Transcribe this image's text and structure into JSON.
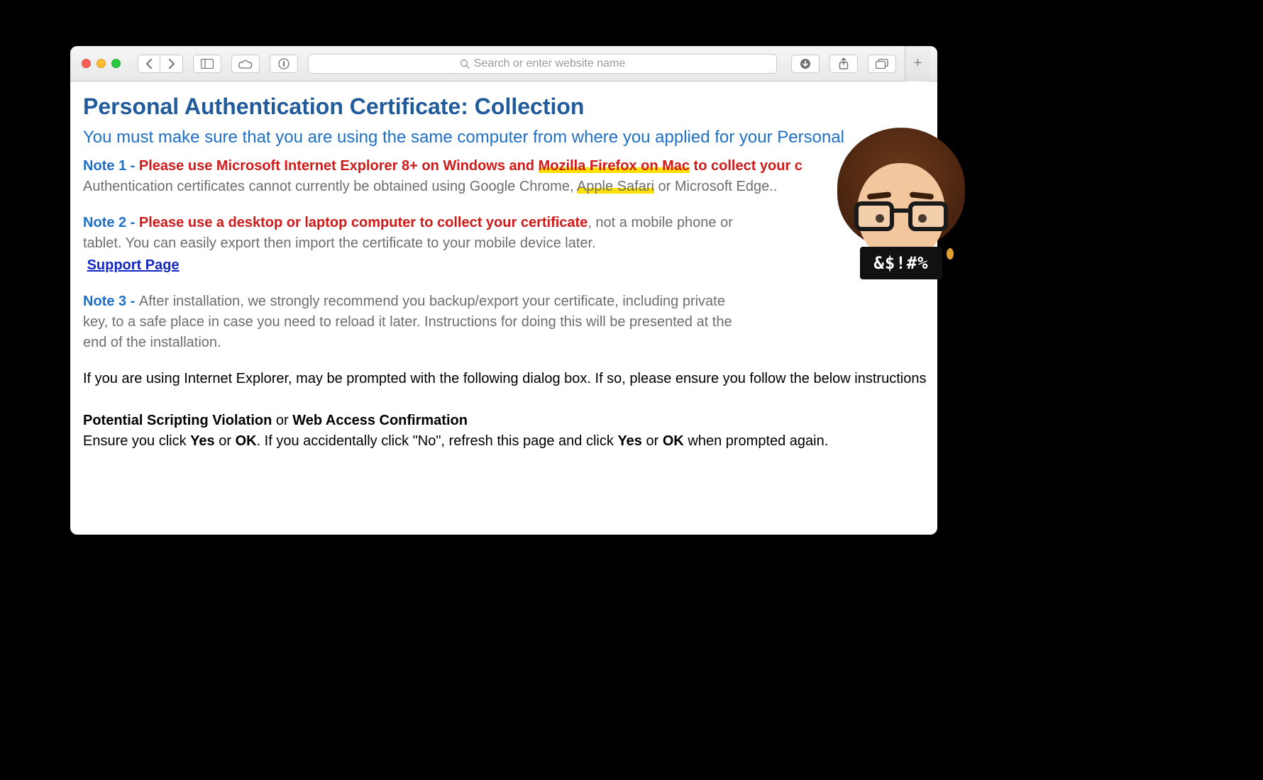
{
  "toolbar": {
    "search_placeholder": "Search or enter website name"
  },
  "page": {
    "title": "Personal Authentication Certificate: Collection",
    "subtitle": "You must make sure that you are using the same computer from where you applied for your Personal",
    "note1_label": "Note 1 - ",
    "note1_red_a": "Please use Microsoft Internet Explorer 8+ on Windows and ",
    "note1_red_hl": "Mozilla Firefox on Mac",
    "note1_red_b": " to collect your c",
    "note1_grey_a": "Authentication certificates cannot currently be obtained using Google Chrome, ",
    "note1_grey_hl": "Apple Safari",
    "note1_grey_b": " or Microsoft Edge..",
    "note2_label": "Note 2 - ",
    "note2_red": "Please use a desktop or laptop computer to collect your certificate",
    "note2_grey": ", not a mobile phone or tablet. You can easily export then import the certificate to your mobile device later.",
    "support_link": "Support Page",
    "note3_label": "Note 3 - ",
    "note3_grey": "After installation, we strongly recommend you backup/export your certificate, including private key, to a safe place in case you need to reload it later. Instructions for doing this will be presented at the end of the installation.",
    "ie_line": "If you are using Internet Explorer, may be prompted with the following dialog box. If so, please ensure you follow the below instructions",
    "psv_a": "Potential Scripting Violation",
    "psv_or": " or ",
    "psv_b": "Web Access Confirmation",
    "ensure_a": "Ensure you click ",
    "yes": "Yes",
    "or_txt": " or ",
    "ok": "OK",
    "ensure_b": ". If you accidentally click \"No\", refresh this page and click ",
    "ensure_c": " when prompted again."
  },
  "memoji": {
    "censor": "&$!#%"
  }
}
